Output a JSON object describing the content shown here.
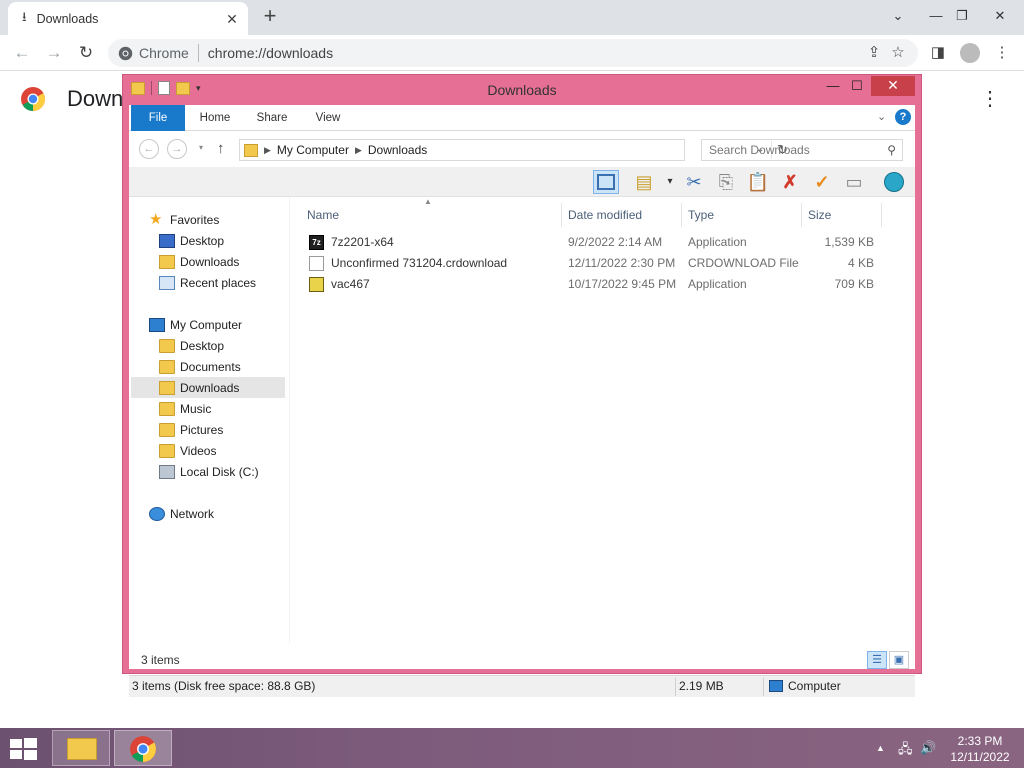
{
  "browser": {
    "tab_title": "Downloads",
    "site_chip": "Chrome",
    "url": "chrome://downloads",
    "page_heading": "Down"
  },
  "explorer": {
    "title": "Downloads",
    "ribbon_tabs": [
      "File",
      "Home",
      "Share",
      "View"
    ],
    "address": {
      "root": "My Computer",
      "current": "Downloads"
    },
    "search_placeholder": "Search Downloads",
    "nav": {
      "favorites": {
        "label": "Favorites",
        "items": [
          "Desktop",
          "Downloads",
          "Recent places"
        ]
      },
      "computer": {
        "label": "My Computer",
        "items": [
          "Desktop",
          "Documents",
          "Downloads",
          "Music",
          "Pictures",
          "Videos",
          "Local Disk (C:)"
        ]
      },
      "network": {
        "label": "Network"
      },
      "selected": "Downloads"
    },
    "columns": [
      "Name",
      "Date modified",
      "Type",
      "Size"
    ],
    "files": [
      {
        "name": "7z2201-x64",
        "date": "9/2/2022 2:14 AM",
        "type": "Application",
        "size": "1,539 KB",
        "icon": "7zip-icon"
      },
      {
        "name": "Unconfirmed 731204.crdownload",
        "date": "12/11/2022 2:30 PM",
        "type": "CRDOWNLOAD File",
        "size": "4 KB",
        "icon": "blank-file-icon"
      },
      {
        "name": "vac467",
        "date": "10/17/2022 9:45 PM",
        "type": "Application",
        "size": "709 KB",
        "icon": "app-icon"
      }
    ],
    "item_count": "3 items",
    "statusbar": {
      "summary": "3 items (Disk free space: 88.8 GB)",
      "size": "2.19 MB",
      "location": "Computer"
    },
    "accent_color": "#e66f95"
  },
  "taskbar": {
    "time": "2:33 PM",
    "date": "12/11/2022"
  }
}
